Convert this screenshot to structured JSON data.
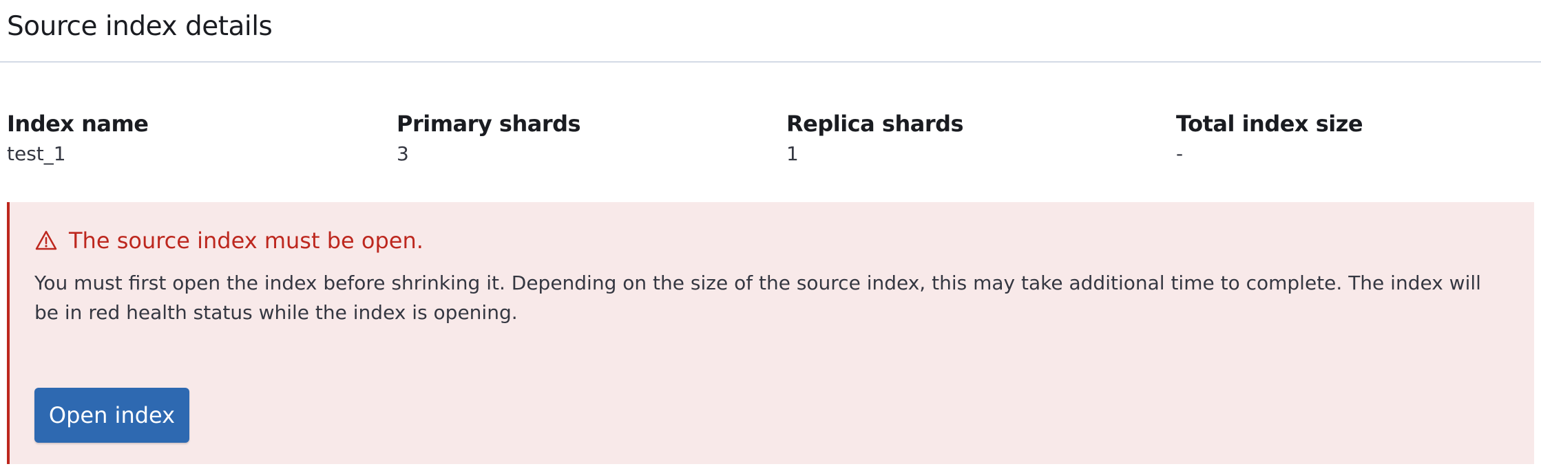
{
  "page_title": "Source index details",
  "stats": [
    {
      "label": "Index name",
      "value": "test_1"
    },
    {
      "label": "Primary shards",
      "value": "3"
    },
    {
      "label": "Replica shards",
      "value": "1"
    },
    {
      "label": "Total index size",
      "value": "-"
    }
  ],
  "callout": {
    "icon": "warning-icon",
    "title": "The source index must be open.",
    "body": "You must first open the index before shrinking it. Depending on the size of the source index, this may take additional time to complete. The index will be in red health status while the index is opening.",
    "button_label": "Open index"
  },
  "colors": {
    "danger": "#bd271e",
    "danger_bg": "#f8e9e9",
    "primary_button": "#2e69b1"
  }
}
